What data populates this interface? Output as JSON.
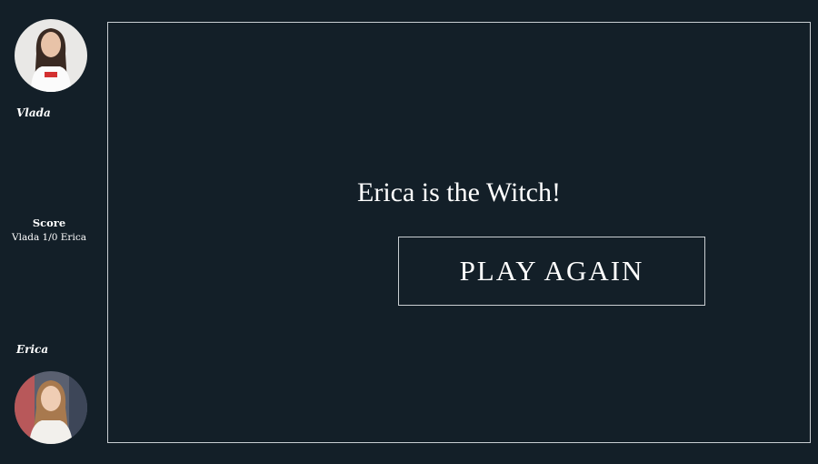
{
  "players": {
    "top": {
      "name": "Vlada"
    },
    "bottom": {
      "name": "Erica"
    }
  },
  "score": {
    "title": "Score",
    "value": "Vlada 1/0 Erica"
  },
  "game": {
    "result": "Erica is the Witch!",
    "play_again_label": "PLAY AGAIN"
  },
  "colors": {
    "background": "#131f28",
    "border": "#c9ced2",
    "text": "#ffffff"
  }
}
